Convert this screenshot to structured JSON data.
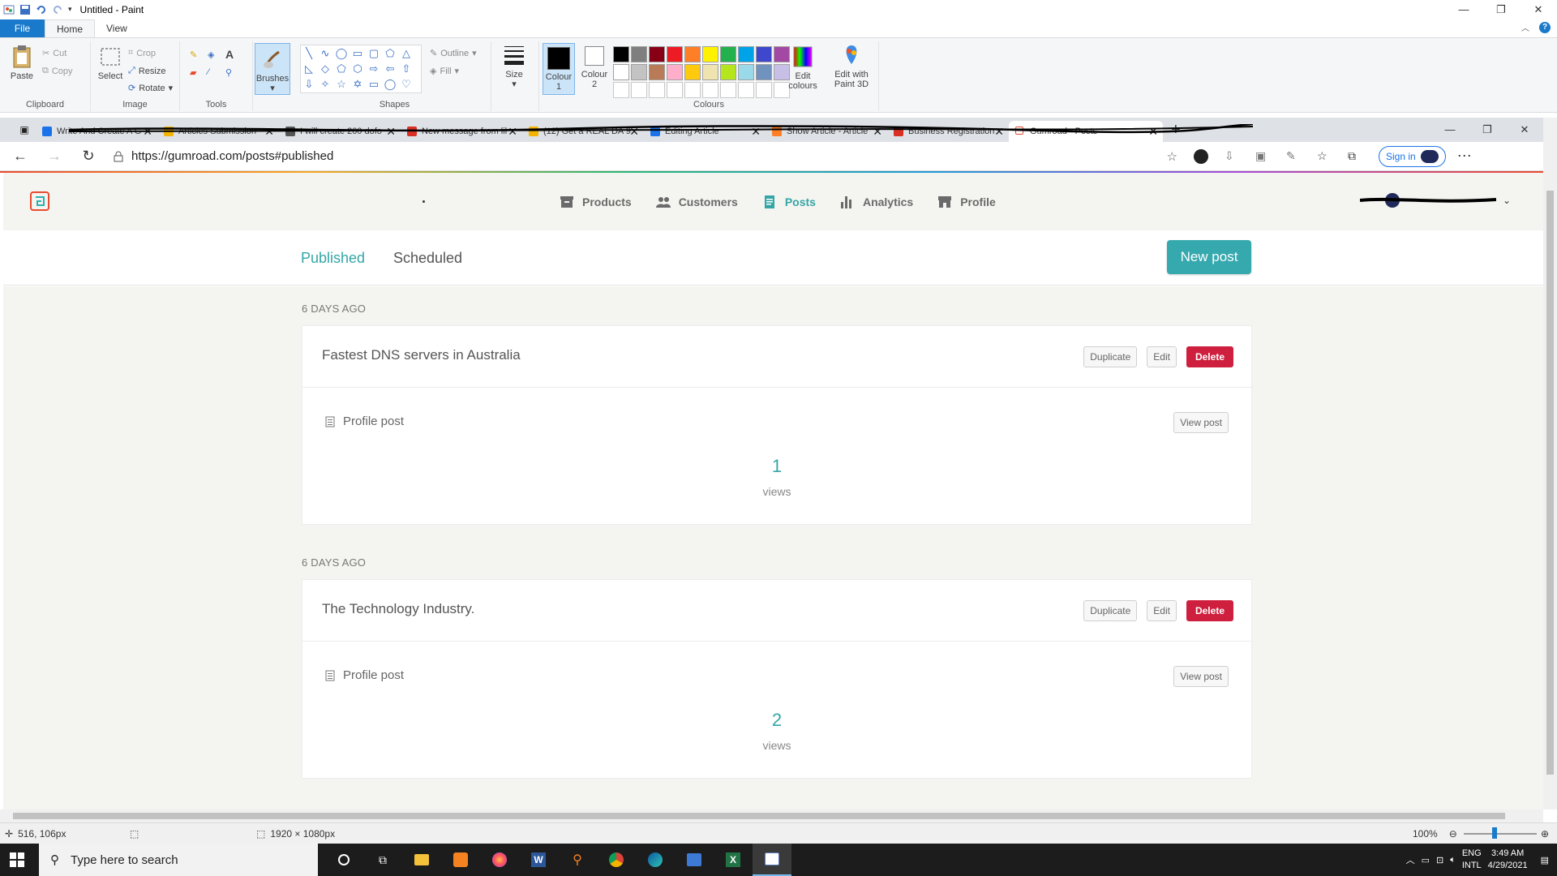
{
  "paint": {
    "title": "Untitled - Paint",
    "menu_tabs": [
      "File",
      "Home",
      "View"
    ],
    "ribbon": {
      "clipboard": {
        "paste": "Paste",
        "cut": "Cut",
        "copy": "Copy",
        "label": "Clipboard"
      },
      "image": {
        "select": "Select",
        "crop": "Crop",
        "resize": "Resize",
        "rotate": "Rotate",
        "label": "Image"
      },
      "tools": {
        "label": "Tools"
      },
      "brushes": "Brushes",
      "shapes": {
        "outline": "Outline",
        "fill": "Fill",
        "label": "Shapes"
      },
      "size": "Size",
      "colour1": "Colour 1",
      "colour2": "Colour 2",
      "colours_label": "Colours",
      "edit_colours": "Edit colours",
      "edit_paint3d": "Edit with Paint 3D",
      "palette": [
        "#000000",
        "#7f7f7f",
        "#880015",
        "#ed1c24",
        "#ff7f27",
        "#fff200",
        "#22b14c",
        "#00a2e8",
        "#3f48cc",
        "#a349a4",
        "#ffffff",
        "#c3c3c3",
        "#b97a57",
        "#ffaec9",
        "#ffc90e",
        "#efe4b0",
        "#b5e61d",
        "#99d9ea",
        "#7092be",
        "#c8bfe7"
      ]
    },
    "status": {
      "cursor": "516, 106px",
      "canvas_size": "1920 × 1080px",
      "zoom": "100%"
    }
  },
  "browser": {
    "tabs": [
      {
        "label": "Write And Create A G",
        "color": "#1a73e8"
      },
      {
        "label": "Articles Submission",
        "color": "#f4b400"
      },
      {
        "label": "I will create 200 dofo",
        "color": "#555555"
      },
      {
        "label": "New message from lil",
        "color": "#d93025"
      },
      {
        "label": "(12) Get a REAL DA 9",
        "color": "#f4b400"
      },
      {
        "label": "Editing Article",
        "color": "#1a73e8"
      },
      {
        "label": "Show Article - Article",
        "color": "#ff7f27"
      },
      {
        "label": "Business Registration",
        "color": "#d93025"
      }
    ],
    "active_tab": "Gumroad - Posts",
    "url": "https://gumroad.com/posts#published",
    "sign_in": "Sign in"
  },
  "gumroad": {
    "nav": [
      {
        "label": "Products",
        "icon": "archive-icon"
      },
      {
        "label": "Customers",
        "icon": "users-icon"
      },
      {
        "label": "Posts",
        "icon": "document-icon"
      },
      {
        "label": "Analytics",
        "icon": "bar-chart-icon"
      },
      {
        "label": "Profile",
        "icon": "store-icon"
      }
    ],
    "active_nav": "Posts",
    "subtabs": {
      "published": "Published",
      "scheduled": "Scheduled"
    },
    "new_post": "New post",
    "posts": [
      {
        "date": "6 DAYS AGO",
        "title": "Fastest DNS servers in Australia",
        "type": "Profile post",
        "views": "1",
        "views_label": "views"
      },
      {
        "date": "6 DAYS AGO",
        "title": "The Technology Industry.",
        "type": "Profile post",
        "views": "2",
        "views_label": "views"
      }
    ],
    "buttons": {
      "duplicate": "Duplicate",
      "edit": "Edit",
      "delete": "Delete",
      "view_post": "View post"
    }
  },
  "taskbar": {
    "search_placeholder": "Type here to search",
    "lang_1": "ENG",
    "lang_2": "INTL",
    "time": "3:49 AM",
    "date": "4/29/2021"
  }
}
